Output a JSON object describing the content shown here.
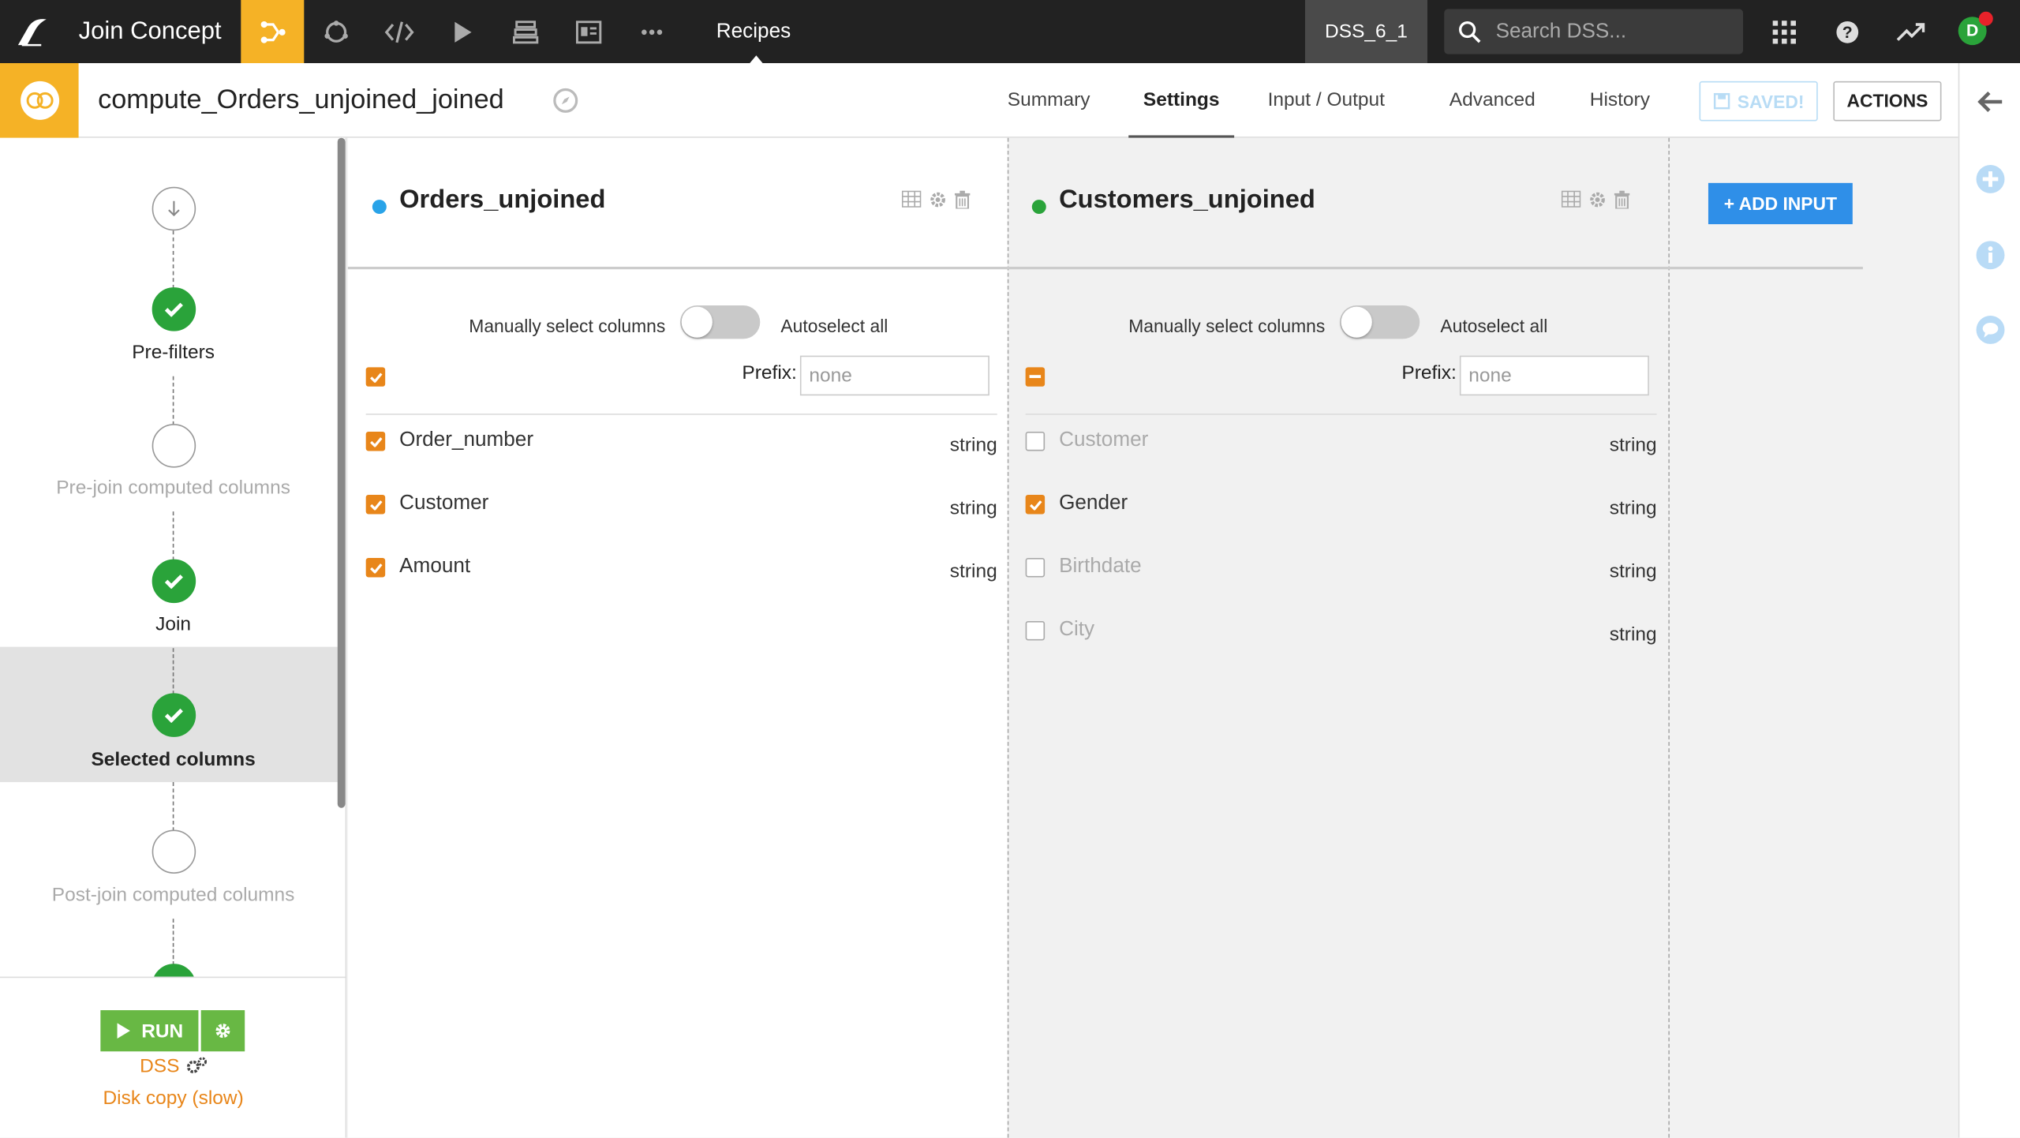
{
  "topbar": {
    "project_name": "Join Concept",
    "current_section": "Recipes",
    "instance": "DSS_6_1",
    "search_placeholder": "Search DSS...",
    "avatar_letter": "D"
  },
  "recipe": {
    "title": "compute_Orders_unjoined_joined",
    "tabs": [
      "Summary",
      "Settings",
      "Input / Output",
      "Advanced",
      "History"
    ],
    "active_tab": "Settings",
    "saved_label": "SAVED!",
    "actions_label": "ACTIONS"
  },
  "steps": [
    {
      "label": "Pre-filters",
      "state": "done"
    },
    {
      "label": "Pre-join computed columns",
      "state": "empty"
    },
    {
      "label": "Join",
      "state": "done"
    },
    {
      "label": "Selected columns",
      "state": "done",
      "selected": true
    },
    {
      "label": "Post-join computed columns",
      "state": "empty"
    }
  ],
  "run": {
    "label": "RUN",
    "engine": "DSS",
    "engine_mode": "Disk copy (slow)"
  },
  "datasets": [
    {
      "name": "Orders_unjoined",
      "dot_color": "#29a3e8",
      "manual_label": "Manually select columns",
      "auto_label": "Autoselect all",
      "prefix_label": "Prefix:",
      "prefix_placeholder": "none",
      "select_all": "checked",
      "columns": [
        {
          "name": "Order_number",
          "type": "string",
          "checked": true
        },
        {
          "name": "Customer",
          "type": "string",
          "checked": true
        },
        {
          "name": "Amount",
          "type": "string",
          "checked": true
        }
      ]
    },
    {
      "name": "Customers_unjoined",
      "dot_color": "#2aa33a",
      "manual_label": "Manually select columns",
      "auto_label": "Autoselect all",
      "prefix_label": "Prefix:",
      "prefix_placeholder": "none",
      "select_all": "partial",
      "columns": [
        {
          "name": "Customer",
          "type": "string",
          "checked": false
        },
        {
          "name": "Gender",
          "type": "string",
          "checked": true
        },
        {
          "name": "Birthdate",
          "type": "string",
          "checked": false
        },
        {
          "name": "City",
          "type": "string",
          "checked": false
        }
      ]
    }
  ],
  "add_input_label": "+ ADD INPUT",
  "colors": {
    "accent_yellow": "#f5b226",
    "check_orange": "#e8861a",
    "run_green": "#68b844",
    "primary_blue": "#2f8fe8"
  }
}
